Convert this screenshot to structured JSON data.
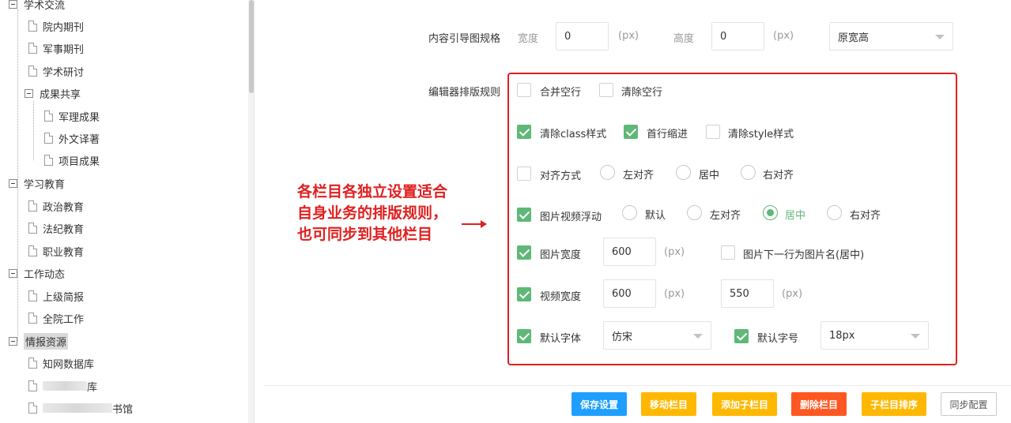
{
  "sidebar": {
    "items": [
      {
        "label": "学术交流",
        "type": "folder"
      },
      {
        "label": "院内期刊",
        "type": "file"
      },
      {
        "label": "军事期刊",
        "type": "file"
      },
      {
        "label": "学术研讨",
        "type": "file"
      },
      {
        "label": "成果共享",
        "type": "folder"
      },
      {
        "label": "军理成果",
        "type": "file"
      },
      {
        "label": "外文译著",
        "type": "file"
      },
      {
        "label": "项目成果",
        "type": "file"
      },
      {
        "label": "学习教育",
        "type": "folder"
      },
      {
        "label": "政治教育",
        "type": "file"
      },
      {
        "label": "法纪教育",
        "type": "file"
      },
      {
        "label": "职业教育",
        "type": "file"
      },
      {
        "label": "工作动态",
        "type": "folder"
      },
      {
        "label": "上级简报",
        "type": "file"
      },
      {
        "label": "全院工作",
        "type": "file"
      },
      {
        "label": "情报资源",
        "type": "folder",
        "selected": true
      },
      {
        "label": "知网数据库",
        "type": "file"
      },
      {
        "label": "库",
        "type": "file"
      },
      {
        "label": "书馆",
        "type": "file"
      }
    ]
  },
  "form": {
    "guide_label": "内容引导图规格",
    "width_label": "宽度",
    "width_value": "0",
    "height_label": "高度",
    "height_value": "0",
    "px": "(px)",
    "size_select": "原宽高",
    "rules_label": "编辑器排版规则",
    "merge_empty": "合并空行",
    "clear_empty": "清除空行",
    "clear_class": "清除class样式",
    "first_indent": "首行缩进",
    "clear_style": "清除style样式",
    "align_mode": "对齐方式",
    "align_left": "左对齐",
    "align_center": "居中",
    "align_right": "右对齐",
    "media_float": "图片视频浮动",
    "float_default": "默认",
    "float_left": "左对齐",
    "float_center": "居中",
    "float_right": "右对齐",
    "img_width": "图片宽度",
    "img_width_value": "600",
    "img_caption": "图片下一行为图片名(居中)",
    "video_width": "视频宽度",
    "video_width_value": "600",
    "video_height_value": "550",
    "default_font": "默认字体",
    "font_value": "仿宋",
    "default_size": "默认字号",
    "size_value": "18px"
  },
  "annotation": {
    "text_line1": "各栏目各独立设置适合",
    "text_line2": "自身业务的排版规则，",
    "text_line3": "也可同步到其他栏目"
  },
  "buttons": {
    "save": "保存设置",
    "move": "移动栏目",
    "add_child": "添加子栏目",
    "delete": "删除栏目",
    "sort_child": "子栏目排序",
    "sync": "同步配置"
  },
  "colors": {
    "accent_green": "#5fb878",
    "annotation_red": "#e02020",
    "btn_blue": "#1e9fff",
    "btn_orange": "#ffb800",
    "btn_red": "#ff5722"
  }
}
